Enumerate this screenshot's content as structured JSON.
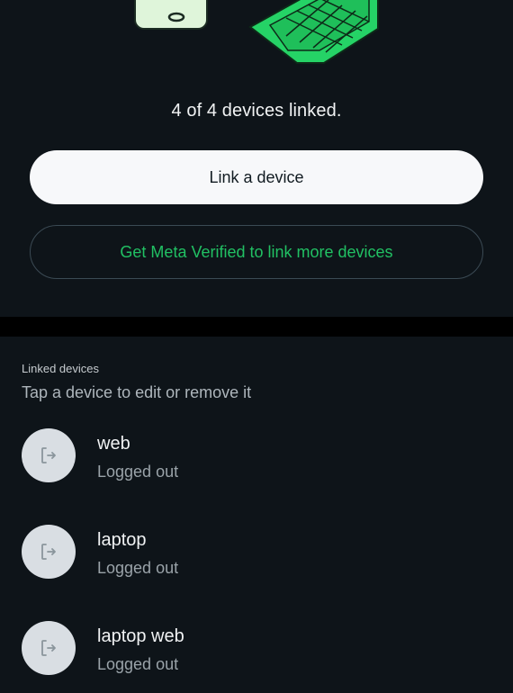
{
  "summary": {
    "linked_count_text": "4 of 4 devices linked."
  },
  "actions": {
    "link_device_label": "Link a device",
    "meta_verified_label": "Get Meta Verified to link more devices"
  },
  "linked_devices": {
    "title": "Linked devices",
    "subtitle": "Tap a device to edit or remove it",
    "items": [
      {
        "name": "web",
        "status": "Logged out",
        "icon": "logout-icon"
      },
      {
        "name": "laptop",
        "status": "Logged out",
        "icon": "logout-icon"
      },
      {
        "name": "laptop web",
        "status": "Logged out",
        "icon": "logout-icon"
      }
    ]
  },
  "colors": {
    "background": "#0e1419",
    "accent_green": "#21c063",
    "button_light": "#f7f8fa",
    "avatar_bg": "#d9dee3"
  }
}
